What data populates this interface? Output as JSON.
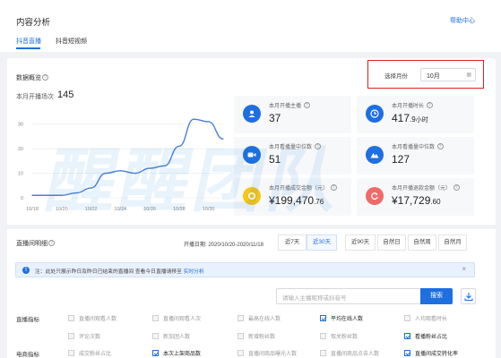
{
  "header": {
    "title": "内容分析",
    "help_link": "帮助中心",
    "tabs": [
      {
        "label": "抖音直播",
        "active": true
      },
      {
        "label": "抖音短视频",
        "active": false
      }
    ]
  },
  "overview": {
    "title": "数据概览",
    "month_label": "选择月份",
    "month_value": "10月",
    "stat_label": "本月开播场次",
    "stat_value": "145"
  },
  "chart_data": {
    "type": "line",
    "x": [
      "10/18",
      "10/19",
      "10/20",
      "10/21",
      "10/22",
      "10/23",
      "10/24",
      "10/25",
      "10/26",
      "10/27",
      "10/28",
      "10/29",
      "10/30",
      "10/31"
    ],
    "values": [
      1,
      1,
      1,
      2,
      4,
      10,
      11,
      10,
      12,
      13,
      21,
      32,
      31,
      24
    ],
    "xticks": [
      "10/18",
      "10/20",
      "10/22",
      "10/24",
      "10/26",
      "10/28",
      "10/30"
    ],
    "yticks": [
      "0",
      "10",
      "20",
      "30"
    ],
    "ylim": [
      0,
      35
    ],
    "color": "#4a7fd6"
  },
  "kpis": [
    {
      "label": "本月开播主播",
      "int": "37",
      "dec": "",
      "unit": "",
      "icon": "user-icon",
      "color": "#1e6fe0"
    },
    {
      "label": "本月开播时长",
      "int": "417",
      "dec": ".9",
      "unit": "小时",
      "icon": "clock-icon",
      "color": "#1e6fe0"
    },
    {
      "label": "本月看播量中位数",
      "int": "51",
      "dec": "",
      "unit": "",
      "icon": "video-icon",
      "color": "#1e6fe0"
    },
    {
      "label": "本月看播量中位数",
      "int": "127",
      "dec": "",
      "unit": "",
      "icon": "mountain-icon",
      "color": "#1e6fe0"
    },
    {
      "label": "本月开播成交金额（元）",
      "int": "¥199,470",
      "dec": ".76",
      "unit": "",
      "icon": "coin-icon",
      "color": "#f5c518"
    },
    {
      "label": "本月开播退款金额（元）",
      "int": "¥17,729",
      "dec": ".60",
      "unit": "",
      "icon": "refund-icon",
      "color": "#f06a6a"
    }
  ],
  "detail": {
    "title": "直播间明细",
    "date_range": "开播日期: 2020/10/20-2020/11/18",
    "periods": [
      {
        "label": "近7天",
        "active": false
      },
      {
        "label": "近30天",
        "active": true
      },
      {
        "label": "近90天",
        "active": false
      },
      {
        "label": "自然日",
        "active": false
      },
      {
        "label": "自然周",
        "active": false
      },
      {
        "label": "自然月",
        "active": false
      }
    ],
    "notice_text": "注：此处只展示昨日及昨日已结束的直播间 查看今日直播请移至",
    "notice_link": "实时分析",
    "search_placeholder": "请输入主播昵称或抖音号",
    "search_button": "搜索"
  },
  "metrics": {
    "row1_label": "直播指标",
    "row1": [
      {
        "label": "直播间观看人数",
        "checked": false
      },
      {
        "label": "直播间观看人次",
        "checked": false
      },
      {
        "label": "最高在线人数",
        "checked": false
      },
      {
        "label": "平均在线人数",
        "checked": true
      },
      {
        "label": "人均观看时长",
        "checked": false
      }
    ],
    "row2": [
      {
        "label": "评论次数",
        "checked": false
      },
      {
        "label": "新加团人数",
        "checked": false
      },
      {
        "label": "新增粉丝数",
        "checked": false
      },
      {
        "label": "取关粉丝数",
        "checked": false
      },
      {
        "label": "看播粉丝占比",
        "checked": true
      }
    ],
    "row3_label": "电商指标",
    "row3": [
      {
        "label": "成交粉丝占比",
        "checked": false
      },
      {
        "label": "本次上架商品数",
        "checked": true
      },
      {
        "label": "直播间商品曝光人数",
        "checked": false
      },
      {
        "label": "直播间商品点击人数",
        "checked": false
      },
      {
        "label": "直播间成交转化率",
        "checked": true
      }
    ]
  },
  "watermark": "醒醒团队"
}
